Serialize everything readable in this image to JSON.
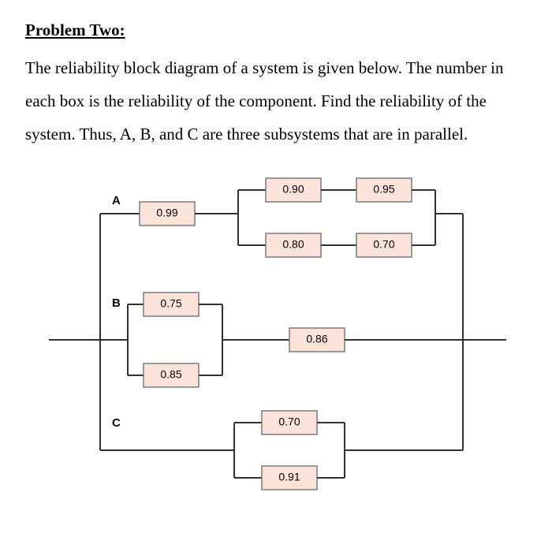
{
  "heading": "Problem Two:",
  "paragraph": "The reliability block diagram of a system is given below. The number in each box is the reliability of the component. Find the reliability of the system. Thus, A, B, and C are three subsystems that are in parallel.",
  "labels": {
    "A": "A",
    "B": "B",
    "C": "C"
  },
  "values": {
    "a_start": "0.99",
    "a_top_1": "0.90",
    "a_top_2": "0.95",
    "a_bot_1": "0.80",
    "a_bot_2": "0.70",
    "b_top": "0.75",
    "b_bot": "0.85",
    "b_series": "0.86",
    "c_top": "0.70",
    "c_bot": "0.91"
  },
  "chart_data": {
    "type": "table",
    "description": "Reliability block diagram. Three parallel subsystems A, B, C between common input/output nodes.",
    "subsystems": [
      {
        "name": "A",
        "structure": "series",
        "components": [
          {
            "reliability": 0.99
          },
          {
            "structure": "parallel",
            "branches": [
              {
                "structure": "series",
                "components": [
                  0.9,
                  0.95
                ]
              },
              {
                "structure": "series",
                "components": [
                  0.8,
                  0.7
                ]
              }
            ]
          }
        ]
      },
      {
        "name": "B",
        "structure": "series",
        "components": [
          {
            "structure": "parallel",
            "branches": [
              0.75,
              0.85
            ]
          },
          {
            "reliability": 0.86
          }
        ]
      },
      {
        "name": "C",
        "structure": "parallel",
        "branches": [
          0.7,
          0.91
        ]
      }
    ]
  }
}
